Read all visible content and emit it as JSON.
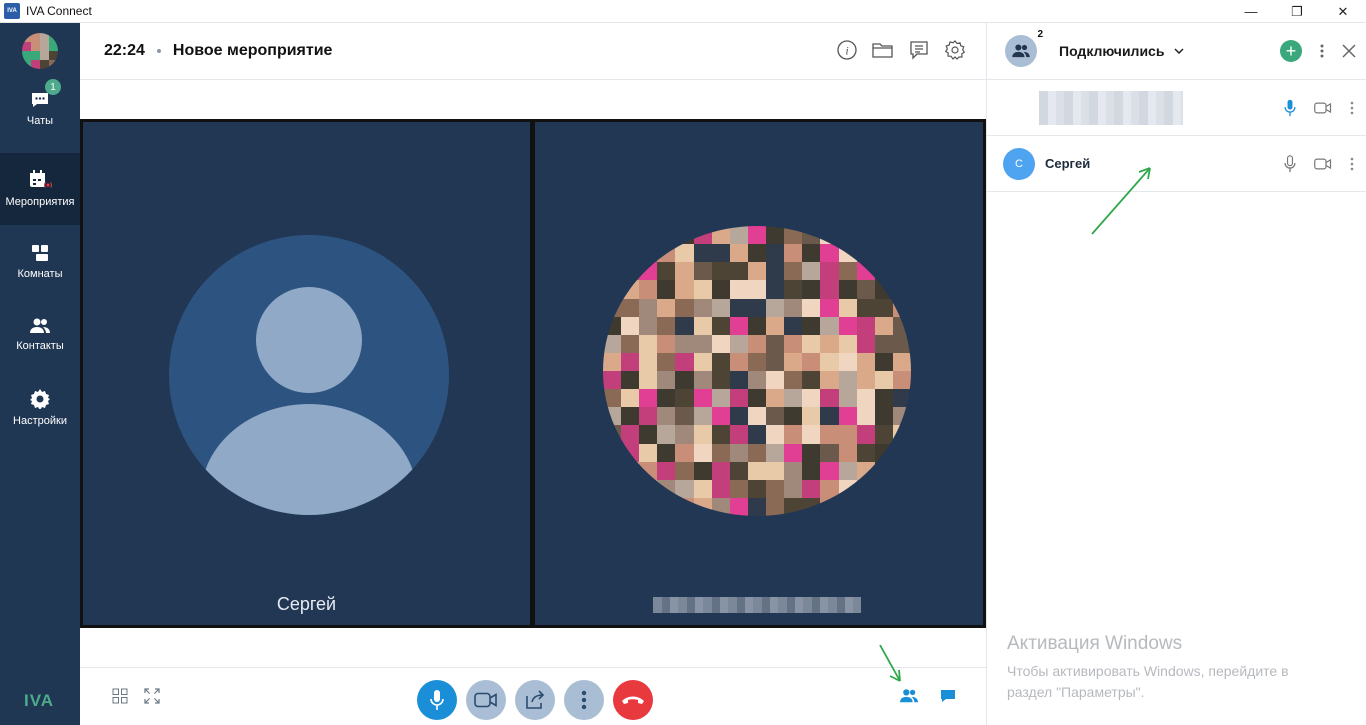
{
  "window": {
    "title": "IVA Connect",
    "minimize": "—",
    "maximize": "❐",
    "close": "✕"
  },
  "sidebar": {
    "items": [
      {
        "label": "Чаты",
        "badge": "1",
        "icon": "chat-icon"
      },
      {
        "label": "Мероприятия",
        "icon": "calendar-live-icon"
      },
      {
        "label": "Комнаты",
        "icon": "rooms-icon"
      },
      {
        "label": "Контакты",
        "icon": "contacts-icon"
      },
      {
        "label": "Настройки",
        "icon": "gear-icon"
      }
    ],
    "logo": "IVA"
  },
  "header": {
    "time": "22:24",
    "title": "Новое мероприятие"
  },
  "stage": {
    "tiles": [
      {
        "name": "Сергей"
      },
      {
        "name": ""
      }
    ]
  },
  "panel": {
    "title": "Подключились",
    "count": "2",
    "participants": [
      {
        "name": "",
        "initial": "",
        "mic_active": true
      },
      {
        "name": "Сергей",
        "initial": "С",
        "mic_active": false
      }
    ]
  },
  "watermark": {
    "title": "Активация Windows",
    "text": "Чтобы активировать Windows, перейдите в раздел \"Параметры\"."
  },
  "colors": {
    "sidebar": "#203753",
    "accent": "#1a8fd8",
    "hangup": "#e8393f",
    "green": "#3aa87a",
    "arrow": "#2fa84a"
  }
}
